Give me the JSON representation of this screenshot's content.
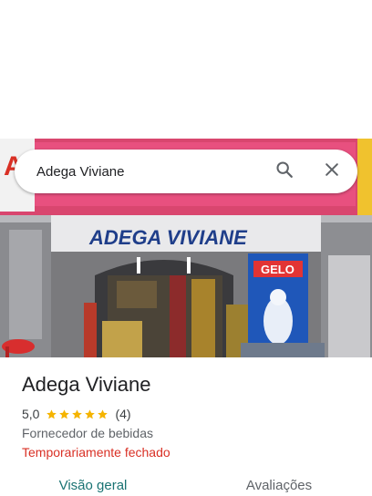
{
  "search": {
    "query": "Adega Viviane"
  },
  "place": {
    "name": "Adega Viviane",
    "rating": "5,0",
    "rating_stars": 5,
    "review_count": "(4)",
    "category": "Fornecedor de bebidas",
    "status": "Temporariamente fechado"
  },
  "photo": {
    "sign_text": "ADEGA VIVIANE",
    "fridge_text": "GELO"
  },
  "tabs": [
    {
      "label": "Visão geral",
      "active": true
    },
    {
      "label": "Avaliações",
      "active": false
    }
  ],
  "colors": {
    "accent": "#1a7373",
    "status_red": "#d93025",
    "star": "#f5b400",
    "sign_pink": "#e23f7e"
  },
  "icons": [
    "search-icon",
    "close-icon",
    "star-icon"
  ]
}
